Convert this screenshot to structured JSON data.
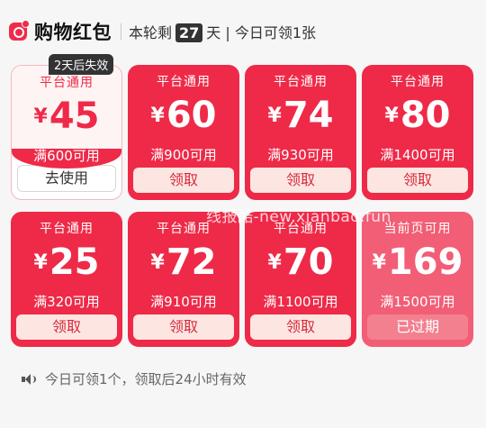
{
  "header": {
    "title": "购物红包",
    "round_prefix": "本轮剩",
    "days": "27",
    "round_suffix": "天 | 今日可领1张"
  },
  "badge": "2天后失效",
  "coupons": [
    {
      "platform": "平台通用",
      "amount": "45",
      "condition": "满600可用",
      "button": "去使用"
    },
    {
      "platform": "平台通用",
      "amount": "60",
      "condition": "满900可用",
      "button": "领取"
    },
    {
      "platform": "平台通用",
      "amount": "74",
      "condition": "满930可用",
      "button": "领取"
    },
    {
      "platform": "平台通用",
      "amount": "80",
      "condition": "满1400可用",
      "button": "领取"
    },
    {
      "platform": "平台通用",
      "amount": "25",
      "condition": "满320可用",
      "button": "领取"
    },
    {
      "platform": "平台通用",
      "amount": "72",
      "condition": "满910可用",
      "button": "领取"
    },
    {
      "platform": "平台通用",
      "amount": "70",
      "condition": "满1100可用",
      "button": "领取"
    },
    {
      "platform": "当前页可用",
      "amount": "169",
      "condition": "满1500可用",
      "button": "已过期"
    }
  ],
  "currency": "¥",
  "watermark": "线报酷-new.xianbao.fun",
  "footer": {
    "text": "今日可领1个，领取后24小时有效"
  },
  "colors": {
    "accent": "#ee2a48",
    "expired": "#f15e76"
  }
}
